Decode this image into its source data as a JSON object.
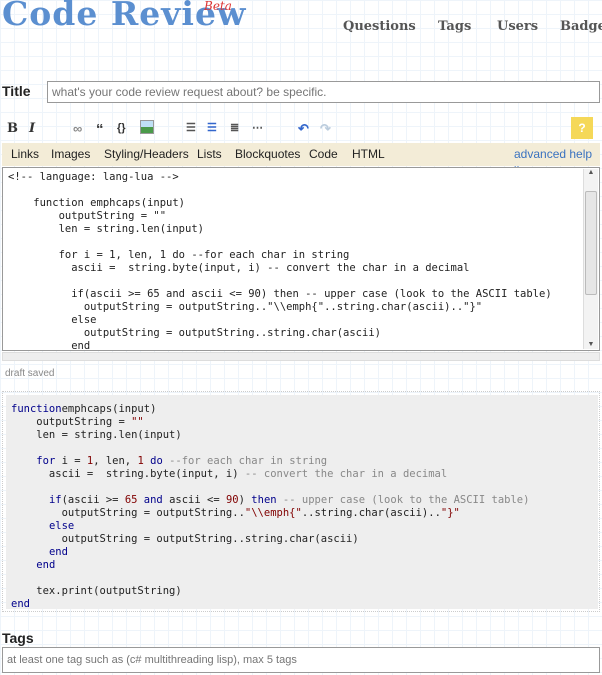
{
  "header": {
    "logo": "Code Review",
    "beta": "Beta",
    "nav": [
      "Questions",
      "Tags",
      "Users",
      "Badges"
    ]
  },
  "title": {
    "label": "Title",
    "placeholder": "what's your code review request about? be specific."
  },
  "toolbar": {
    "icons": [
      "bold-icon",
      "italic-icon",
      "link-icon",
      "blockquote-icon",
      "code-icon",
      "image-icon",
      "numbered-list-icon",
      "bulleted-list-icon",
      "heading-icon",
      "horizontal-rule-icon",
      "undo-icon",
      "redo-icon",
      "help-icon"
    ]
  },
  "helpbar": {
    "items": [
      "Links",
      "Images",
      "Styling/Headers",
      "Lists",
      "Blockquotes",
      "Code",
      "HTML"
    ],
    "advanced": "advanced help »"
  },
  "editor": {
    "text": "<!-- language: lang-lua -->\n\n    function emphcaps(input)\n        outputString = \"\"\n        len = string.len(input)\n\n        for i = 1, len, 1 do --for each char in string\n          ascii =  string.byte(input, i) -- convert the char in a decimal\n\n          if(ascii >= 65 and ascii <= 90) then -- upper case (look to the ASCII table)\n            outputString = outputString..\"\\\\emph{\"..string.char(ascii)..\"}\"\n          else\n            outputString = outputString..string.char(ascii)\n          end"
  },
  "draft_status": "draft saved",
  "preview": {
    "lines": [
      [
        [
          "k",
          "function"
        ],
        [
          "",
          "emphcaps(input)"
        ]
      ],
      [
        [
          "",
          "    outputString = "
        ],
        [
          "s",
          "\"\""
        ]
      ],
      [
        [
          "",
          "    len = string.len(input)"
        ]
      ],
      [
        [
          "",
          ""
        ]
      ],
      [
        [
          "",
          "    "
        ],
        [
          "k",
          "for"
        ],
        [
          "",
          " i = "
        ],
        [
          "n",
          "1"
        ],
        [
          "",
          ", len, "
        ],
        [
          "n",
          "1"
        ],
        [
          "",
          ""
        ],
        [
          "k",
          " do"
        ],
        [
          "c",
          " --for each char in string"
        ]
      ],
      [
        [
          "",
          "      ascii =  string.byte(input, i) "
        ],
        [
          "c",
          "-- convert the char in a decimal"
        ]
      ],
      [
        [
          "",
          ""
        ]
      ],
      [
        [
          "",
          "      "
        ],
        [
          "k",
          "if"
        ],
        [
          "",
          "(ascii >= "
        ],
        [
          "n",
          "65"
        ],
        [
          "k",
          " and"
        ],
        [
          "",
          " ascii <= "
        ],
        [
          "n",
          "90"
        ],
        [
          "",
          ") "
        ],
        [
          "k",
          "then"
        ],
        [
          "c",
          " -- upper case (look to the ASCII table)"
        ]
      ],
      [
        [
          "",
          "        outputString = outputString.."
        ],
        [
          "s",
          "\"\\\\emph{\""
        ],
        [
          "",
          "..string.char(ascii).."
        ],
        [
          "s",
          "\"}\""
        ]
      ],
      [
        [
          "",
          "      "
        ],
        [
          "k",
          "else"
        ]
      ],
      [
        [
          "",
          "        outputString = outputString..string.char(ascii)"
        ]
      ],
      [
        [
          "",
          "      "
        ],
        [
          "k",
          "end"
        ]
      ],
      [
        [
          "",
          "    "
        ],
        [
          "k",
          "end"
        ]
      ],
      [
        [
          "",
          ""
        ]
      ],
      [
        [
          "",
          "    tex.print(outputString)"
        ]
      ],
      [
        [
          "k",
          "end"
        ]
      ]
    ]
  },
  "tags": {
    "label": "Tags",
    "placeholder": "at least one tag such as (c# multithreading lisp), max 5 tags"
  }
}
